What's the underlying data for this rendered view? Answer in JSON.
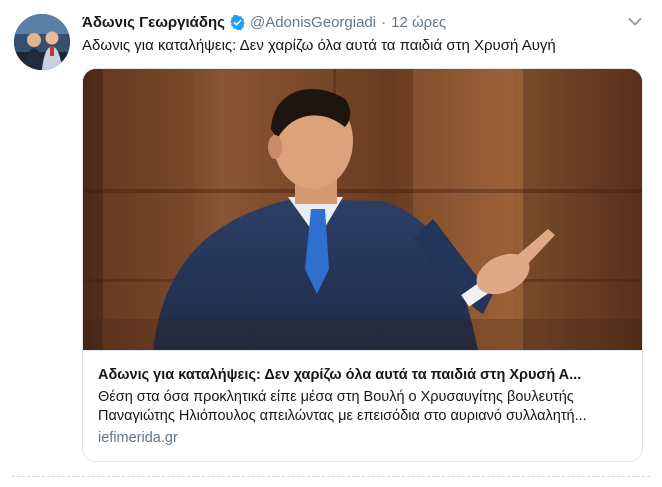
{
  "tweet": {
    "author_name": "Άδωνις Γεωργιάδης",
    "handle": "@AdonisGeorgiadi",
    "separator": "·",
    "timestamp": "12 ώρες",
    "text": "Αδωνις για καταλήψεις: Δεν χαρίζω όλα αυτά τα παιδιά στη Χρυσή Αυγή",
    "verified": true
  },
  "card": {
    "title": "Αδωνις για καταλήψεις: Δεν χαρίζω όλα αυτά τα παιδιά στη Χρυσή Α...",
    "description_line1": "Θέση στα όσα προκλητικά είπε μέσα στη Βουλή ο Χρυσαυγίτης βουλευτής",
    "description_line2": "Παναγιώτης Ηλιόπουλος απειλώντας με επεισόδια στο αυριανό συλλαλητή...",
    "domain": "iefimerida.gr"
  },
  "icons": {
    "verified": "verified-badge-icon",
    "menu": "chevron-down-icon"
  },
  "colors": {
    "verified_blue": "#1da1f2",
    "secondary_text": "#657786",
    "border": "#e1e8ed"
  }
}
